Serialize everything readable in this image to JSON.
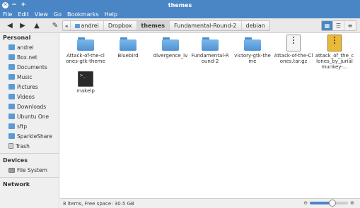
{
  "window": {
    "title": "themes"
  },
  "menu": [
    "File",
    "Edit",
    "View",
    "Go",
    "Bookmarks",
    "Help"
  ],
  "path": [
    "andrei",
    "Dropbox",
    "themes",
    "Fundamental-Round-2",
    "debian"
  ],
  "active_crumb": "themes",
  "sidebar": {
    "personal_header": "Personal",
    "personal_items": [
      {
        "label": "andrei",
        "icon": "home-folder-icon"
      },
      {
        "label": "Box.net",
        "icon": "folder-icon"
      },
      {
        "label": "Documents",
        "icon": "folder-icon"
      },
      {
        "label": "Music",
        "icon": "folder-icon"
      },
      {
        "label": "Pictures",
        "icon": "folder-icon"
      },
      {
        "label": "Videos",
        "icon": "folder-icon"
      },
      {
        "label": "Downloads",
        "icon": "folder-icon"
      },
      {
        "label": "Ubuntu One",
        "icon": "folder-icon"
      },
      {
        "label": "sftp",
        "icon": "folder-icon"
      },
      {
        "label": "SparkleShare",
        "icon": "folder-icon"
      },
      {
        "label": "Trash",
        "icon": "trash-icon"
      }
    ],
    "devices_header": "Devices",
    "devices_items": [
      {
        "label": "File System",
        "icon": "drive-icon"
      }
    ],
    "network_header": "Network"
  },
  "files": [
    {
      "label": "Attack-of-the-clones-gtk-theme",
      "type": "folder"
    },
    {
      "label": "Bluebird",
      "type": "folder"
    },
    {
      "label": "divergence_iv",
      "type": "folder"
    },
    {
      "label": "Fundamental-Round-2",
      "type": "folder"
    },
    {
      "label": "victory-gtk-theme",
      "type": "folder"
    },
    {
      "label": "Attack-of-the-Clones.tar.gz",
      "type": "archive"
    },
    {
      "label": "attack_of_the_clones_by_jurialmunkey-...",
      "type": "archive-gold"
    },
    {
      "label": "makelp",
      "type": "terminal"
    }
  ],
  "status": {
    "text": "8 items, Free space: 30.5 GB",
    "zoom_level": 0.6
  },
  "colors": {
    "accent": "#4a86c5",
    "folder": "#5a9bd6"
  }
}
